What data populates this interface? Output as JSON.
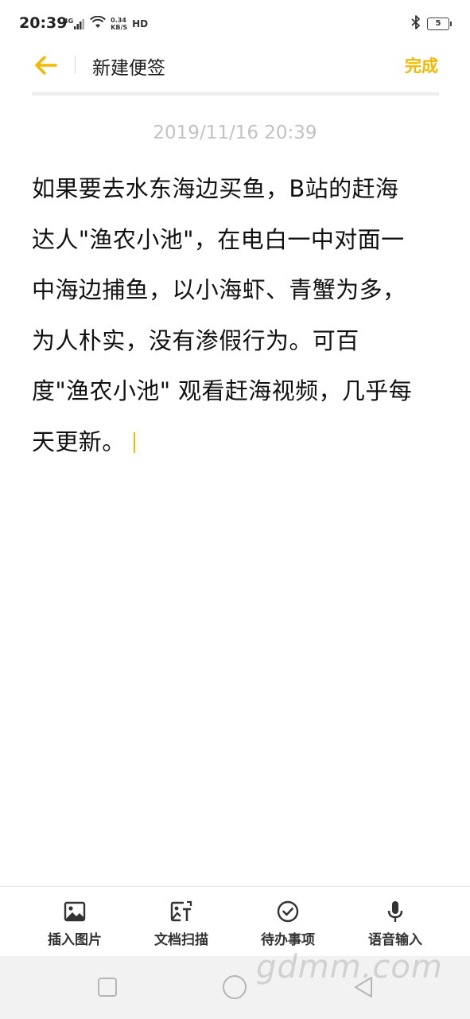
{
  "status_bar": {
    "time": "20:39",
    "network": "4G",
    "speed_value": "0.34",
    "speed_unit": "KB/S",
    "hd": "HD",
    "battery": "5"
  },
  "header": {
    "title": "新建便签",
    "done_label": "完成"
  },
  "note": {
    "timestamp": "2019/11/16 20:39",
    "lines": [
      "如果要去水东海边买鱼，B站的赶海",
      "达人\"渔农小池\"，在电白一中对面一",
      "中海边捕鱼，以小海虾、青蟹为多，",
      "为人朴实，没有渗假行为。可百",
      "度\"渔农小池\" 观看赶海视频，几乎每",
      "天更新。"
    ]
  },
  "toolbar": {
    "insert_image": "插入图片",
    "doc_scan": "文档扫描",
    "todo": "待办事项",
    "voice_input": "语音输入"
  },
  "watermark": "gdmm.com",
  "colors": {
    "accent": "#f5b800",
    "timestamp": "#c2c2c2",
    "navbar_bg": "#f2f2f2"
  }
}
